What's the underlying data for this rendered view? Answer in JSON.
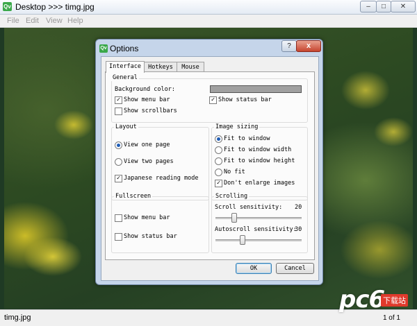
{
  "window": {
    "title": "Desktop >>> timg.jpg",
    "app_icon": "Qv",
    "minimize": "–",
    "maximize": "□",
    "close": "✕"
  },
  "menu": [
    "File",
    "Edit",
    "View",
    "Help"
  ],
  "status": {
    "filename": "timg.jpg",
    "page": "1 of 1"
  },
  "watermark": {
    "brand": "pc6",
    "tag": "下载站"
  },
  "dialog": {
    "title": "Options",
    "help": "?",
    "close": "x",
    "tabs": [
      "Interface",
      "Hotkeys",
      "Mouse"
    ],
    "general": {
      "label": "General",
      "bg_color_label": "Background color:",
      "bg_color": "#a0a0a0",
      "show_menu_bar": "Show menu bar",
      "show_menu_bar_checked": true,
      "show_status_bar": "Show status bar",
      "show_status_bar_checked": true,
      "show_scrollbars": "Show scrollbars",
      "show_scrollbars_checked": false
    },
    "layout": {
      "label": "Layout",
      "view_one": "View one page",
      "view_two": "View two pages",
      "japanese": "Japanese reading mode",
      "japanese_checked": true
    },
    "sizing": {
      "label": "Image sizing",
      "options": [
        "Fit to window",
        "Fit to window width",
        "Fit to window height",
        "No fit"
      ],
      "selected": "Fit to window",
      "dont_enlarge": "Don't enlarge images",
      "dont_enlarge_checked": true
    },
    "fullscreen": {
      "label": "Fullscreen",
      "show_menu_bar": "Show menu bar",
      "show_status_bar": "Show status bar"
    },
    "scrolling": {
      "label": "Scrolling",
      "scroll_label": "Scroll sensitivity:",
      "scroll_value": "20",
      "autoscroll_label": "Autoscroll sensitivity:",
      "autoscroll_value": "30"
    },
    "ok": "OK",
    "cancel": "Cancel"
  }
}
